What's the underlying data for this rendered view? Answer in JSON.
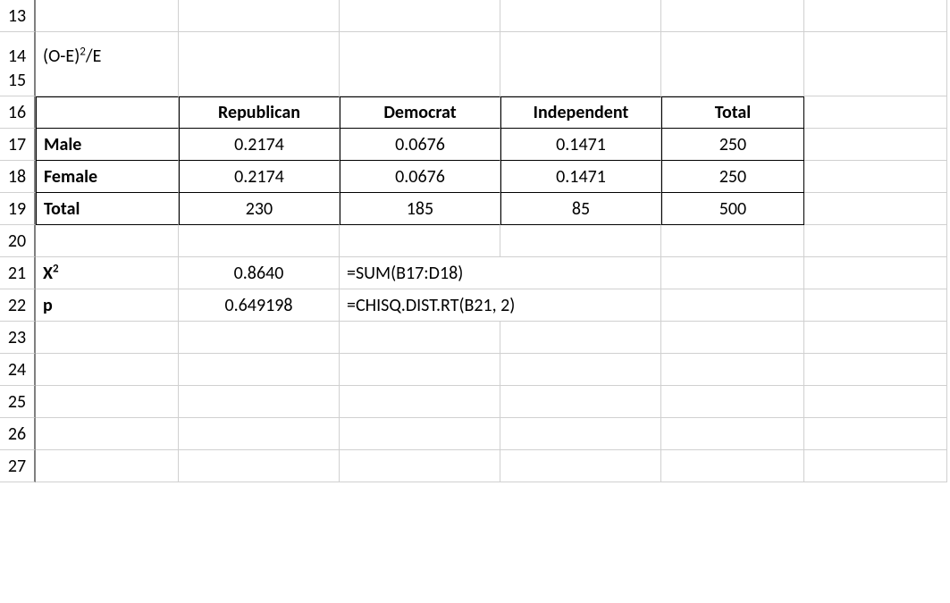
{
  "rows": [
    "13",
    "14",
    "15",
    "16",
    "17",
    "18",
    "19",
    "20",
    "21",
    "22",
    "23",
    "24",
    "25",
    "26",
    "27"
  ],
  "a14": {
    "pre": "(O-E)",
    "sup": "2",
    "post": "/E"
  },
  "headers": {
    "b": "Republican",
    "c": "Democrat",
    "d": "Independent",
    "e": "Total"
  },
  "r17": {
    "a": "Male",
    "b": "0.2174",
    "c": "0.0676",
    "d": "0.1471",
    "e": "250"
  },
  "r18": {
    "a": "Female",
    "b": "0.2174",
    "c": "0.0676",
    "d": "0.1471",
    "e": "250"
  },
  "r19": {
    "a": "Total",
    "b": "230",
    "c": "185",
    "d": "85",
    "e": "500"
  },
  "x2": {
    "label_pre": "X",
    "label_sup": "2",
    "value": "0.8640",
    "formula": "=SUM(B17:D18)"
  },
  "p": {
    "label": "p",
    "value": "0.649198",
    "formula": "=CHISQ.DIST.RT(B21, 2)"
  },
  "chart_data": {
    "type": "table",
    "title": "(O-E)^2/E",
    "columns": [
      "",
      "Republican",
      "Democrat",
      "Independent",
      "Total"
    ],
    "rows": [
      [
        "Male",
        0.2174,
        0.0676,
        0.1471,
        250
      ],
      [
        "Female",
        0.2174,
        0.0676,
        0.1471,
        250
      ],
      [
        "Total",
        230,
        185,
        85,
        500
      ]
    ],
    "stats": {
      "X2": 0.864,
      "p": 0.649198
    }
  }
}
